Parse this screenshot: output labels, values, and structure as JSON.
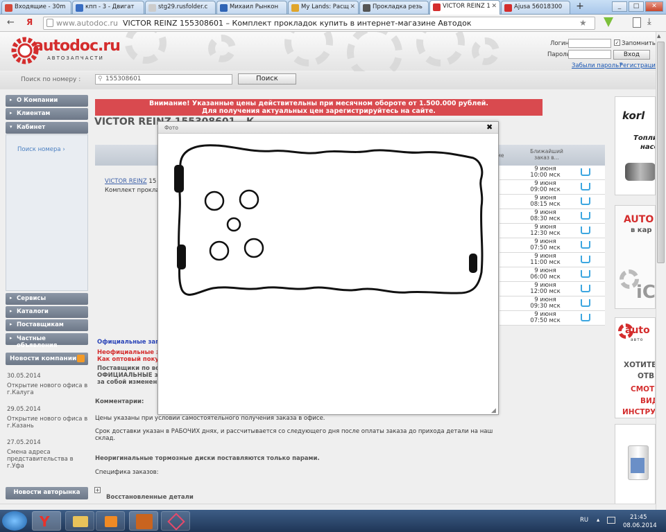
{
  "browser": {
    "tabs": [
      {
        "label": "Входящие - 30m",
        "active": false
      },
      {
        "label": "кпп - 3 - Двигат",
        "active": false
      },
      {
        "label": "stg29.rusfolder.c",
        "active": false
      },
      {
        "label": "Михаил Рынкон",
        "active": false
      },
      {
        "label": "My Lands: Расщ",
        "active": false
      },
      {
        "label": "Прокладка резь",
        "active": false
      },
      {
        "label": "VICTOR REINZ 1",
        "active": true
      },
      {
        "label": "Ajusa 56018300",
        "active": false
      }
    ],
    "new_tab": "+",
    "window_buttons": [
      "_",
      "□",
      "✕"
    ],
    "url_domain": "www.autodoc.ru",
    "url_title": "VICTOR REINZ 155308601 – Комплект прокладок купить в интернет-магазине Автодок",
    "back": "←",
    "ya": "Я"
  },
  "header": {
    "logo": "autodoc.ru",
    "logo_sub": "АВТОЗАПЧАСТИ",
    "login_label": "Логин",
    "remember_label": "Запомнить",
    "password_label": "Пароль",
    "login_button": "Вход",
    "forgot_link": "Забыли пароль?",
    "register_link": "Регистрация"
  },
  "search": {
    "label": "Поиск по номеру :",
    "value": "155308601",
    "button": "Поиск"
  },
  "nav": {
    "company": "О Компании",
    "clients": "Клиентам",
    "cabinet": "Кабинет",
    "search_by_number": "Поиск номера",
    "services": "Сервисы",
    "catalogs": "Каталоги",
    "suppliers": "Поставщикам",
    "private_ads": "Частные объявления",
    "news_title": "Новости компании",
    "news": [
      {
        "date": "30.05.2014",
        "text": "Открытие нового офиса в г.Калуга"
      },
      {
        "date": "29.05.2014",
        "text": "Открытие нового офиса в г.Казань"
      },
      {
        "date": "27.05.2014",
        "text": "Смена адреса представительства в г.Уфа"
      }
    ],
    "author_news": "Новости авторынка"
  },
  "main": {
    "warning_line1": "Внимание! Указанные цены действительны при месячном обороте от 1.500.000 рублей.",
    "warning_line2": "Для получения актуальных цен зарегистрируйтесь на сайте.",
    "title": "VICTOR REINZ 155308601 - К",
    "table_header_nearest": "Ближайший заказ в...",
    "table_header_partial": "ие",
    "brand_link": "VICTOR REINZ",
    "brand_suffix": "15",
    "product_partial": "Комплект прокла",
    "rows": [
      {
        "date": "9 июня",
        "time": "10:00 мск"
      },
      {
        "date": "9 июня",
        "time": "09:00 мск"
      },
      {
        "date": "9 июня",
        "time": "08:15 мск"
      },
      {
        "date": "9 июня",
        "time": "08:30 мск"
      },
      {
        "date": "9 июня",
        "time": "12:30 мск"
      },
      {
        "date": "9 июня",
        "time": "07:50 мск"
      },
      {
        "date": "9 июня",
        "time": "11:00 мск"
      },
      {
        "date": "9 июня",
        "time": "06:00 мск"
      },
      {
        "date": "9 июня",
        "time": "12:00 мск"
      },
      {
        "date": "9 июня",
        "time": "09:30 мск"
      },
      {
        "date": "9 июня",
        "time": "07:50 мск"
      }
    ],
    "official_partial": "Официальные зап",
    "unofficial_partial1": "Неофициальные з",
    "unofficial_partial2": "Как оптовый покуп",
    "suppliers_partial1": "Поставщики по во",
    "suppliers_partial2": "ОФИЦИАЛЬНЫЕ за",
    "suppliers_partial3": "за собой изменен",
    "comments_label": "Комментарии:",
    "note1": "Цены указаны при условии самостоятельного получения заказа в офисе.",
    "note2": "Срок доставки указан в РАБОЧИХ днях, и рассчитывается со следующего дня после оплаты заказа до прихода детали на наш склад.",
    "note3": "Неоригинальные тормозные диски поставляются только парами.",
    "note4": "Специфика заказов:",
    "restored": "Восстановленные детали",
    "expand": "+"
  },
  "modal": {
    "title": "Фото",
    "close": "✖"
  },
  "ads": {
    "ad1_line1": "korl",
    "ad1_line2": "Топли",
    "ad1_line3": "насо",
    "ad2_line1": "AUTO",
    "ad2_line2": "в кар",
    "ad2_line3": "iC",
    "ad3_logo": "auto",
    "ad3_sub": "авто",
    "ad3_l1": "ХОТИТЕ",
    "ad3_l2": "ОТВЕ",
    "ad3_l3": "СМОТ",
    "ad3_l4": "ВИД",
    "ad3_l5": "ИНСТРУ"
  },
  "taskbar": {
    "lang": "RU",
    "time": "21:45",
    "date": "08.06.2014"
  }
}
